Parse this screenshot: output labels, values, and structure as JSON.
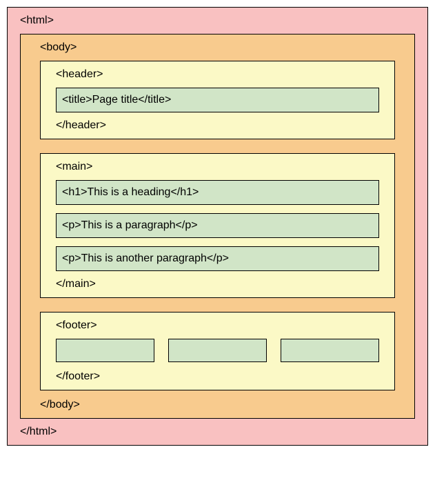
{
  "html": {
    "open": "<html>",
    "close": "</html>",
    "body": {
      "open": "<body>",
      "close": "</body>",
      "header": {
        "open": "<header>",
        "close": "</header>",
        "title": "<title>Page title</title>"
      },
      "main": {
        "open": "<main>",
        "close": "</main>",
        "h1": "<h1>This is a heading</h1>",
        "p1": "<p>This is a paragraph</p>",
        "p2": "<p>This is another paragraph</p>"
      },
      "footer": {
        "open": "<footer>",
        "close": "</footer>"
      }
    }
  }
}
